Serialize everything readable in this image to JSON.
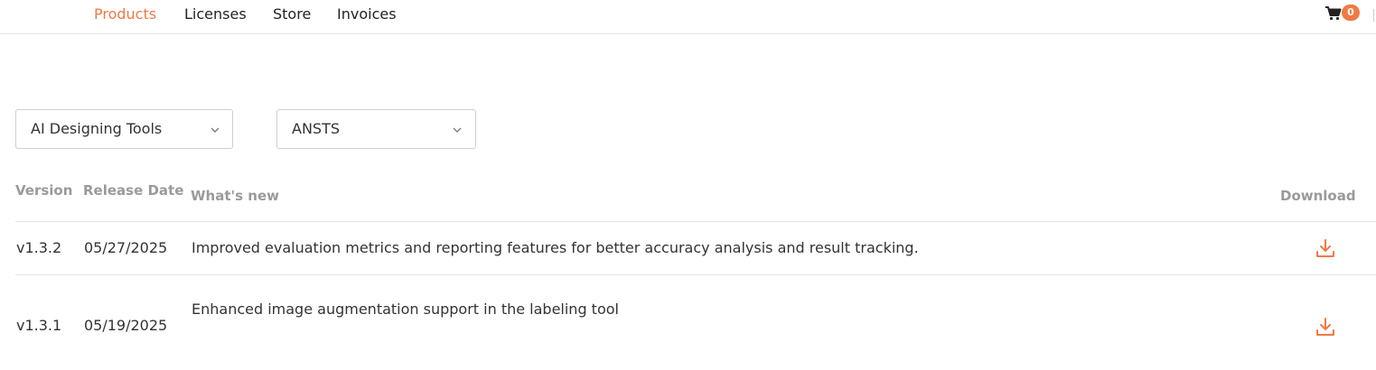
{
  "nav": {
    "items": [
      {
        "label": "Products",
        "active": true
      },
      {
        "label": "Licenses",
        "active": false
      },
      {
        "label": "Store",
        "active": false
      },
      {
        "label": "Invoices",
        "active": false
      }
    ],
    "cart_icon": "shopping-cart-icon",
    "cart_count": "0"
  },
  "filters": {
    "category": {
      "value": "AI Designing Tools"
    },
    "product": {
      "value": "ANSTS"
    }
  },
  "table": {
    "headers": {
      "version": "Version",
      "release_date": "Release Date",
      "whats_new": "What's new",
      "download": "Download"
    },
    "rows": [
      {
        "version": "v1.3.2",
        "release_date": "05/27/2025",
        "whats_new": "Improved evaluation metrics and reporting features for better accuracy analysis and result tracking.",
        "download_icon": "download-icon"
      },
      {
        "version": "v1.3.1",
        "release_date": "05/19/2025",
        "whats_new": "Enhanced image augmentation support in the labeling tool",
        "download_icon": "download-icon"
      }
    ]
  },
  "colors": {
    "accent": "#f07a45",
    "header_text": "#9a9a9a",
    "body_text": "#333333"
  }
}
